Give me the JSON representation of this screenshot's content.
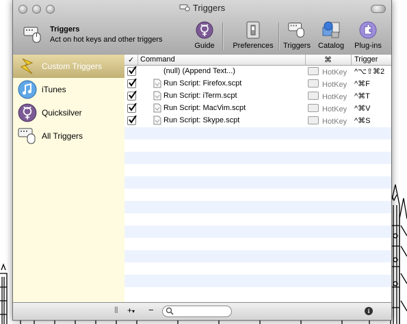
{
  "window": {
    "title": "Triggers"
  },
  "header": {
    "title": "Triggers",
    "subtitle": "Act on hot keys and other triggers"
  },
  "toolbar": [
    {
      "label": "Guide",
      "icon": "quicksilver-icon"
    },
    {
      "label": "Preferences",
      "icon": "switch-icon"
    },
    {
      "label": "Triggers",
      "icon": "keyboard-mouse-icon"
    },
    {
      "label": "Catalog",
      "icon": "catalog-icon"
    },
    {
      "label": "Plug-ins",
      "icon": "puzzle-icon"
    }
  ],
  "sidebar": {
    "items": [
      {
        "label": "Custom Triggers",
        "icon": "lightning-icon",
        "selected": true
      },
      {
        "label": "iTunes",
        "icon": "itunes-icon",
        "selected": false
      },
      {
        "label": "Quicksilver",
        "icon": "quicksilver-icon",
        "selected": false
      },
      {
        "label": "All Triggers",
        "icon": "keyboard-mouse-icon",
        "selected": false
      }
    ]
  },
  "table": {
    "columns": {
      "check": "✓",
      "command": "Command",
      "type": "⌘",
      "trigger": "Trigger"
    },
    "rows": [
      {
        "checked": true,
        "command": "(null) (Append Text...)",
        "type": "HotKey",
        "trigger": "^⌥⇧⌘2",
        "has_script_icon": false
      },
      {
        "checked": true,
        "command": "Run Script: Firefox.scpt",
        "type": "HotKey",
        "trigger": "^⌘F",
        "has_script_icon": true
      },
      {
        "checked": true,
        "command": "Run Script: iTerm.scpt",
        "type": "HotKey",
        "trigger": "^⌘T",
        "has_script_icon": true
      },
      {
        "checked": true,
        "command": "Run Script: MacVim.scpt",
        "type": "HotKey",
        "trigger": "^⌘V",
        "has_script_icon": true
      },
      {
        "checked": true,
        "command": "Run Script: Skype.scpt",
        "type": "HotKey",
        "trigger": "^⌘S",
        "has_script_icon": true
      }
    ]
  },
  "bottom": {
    "add": "+",
    "add_arrow": "▾",
    "remove": "−",
    "resize": "|||",
    "info": "i"
  }
}
